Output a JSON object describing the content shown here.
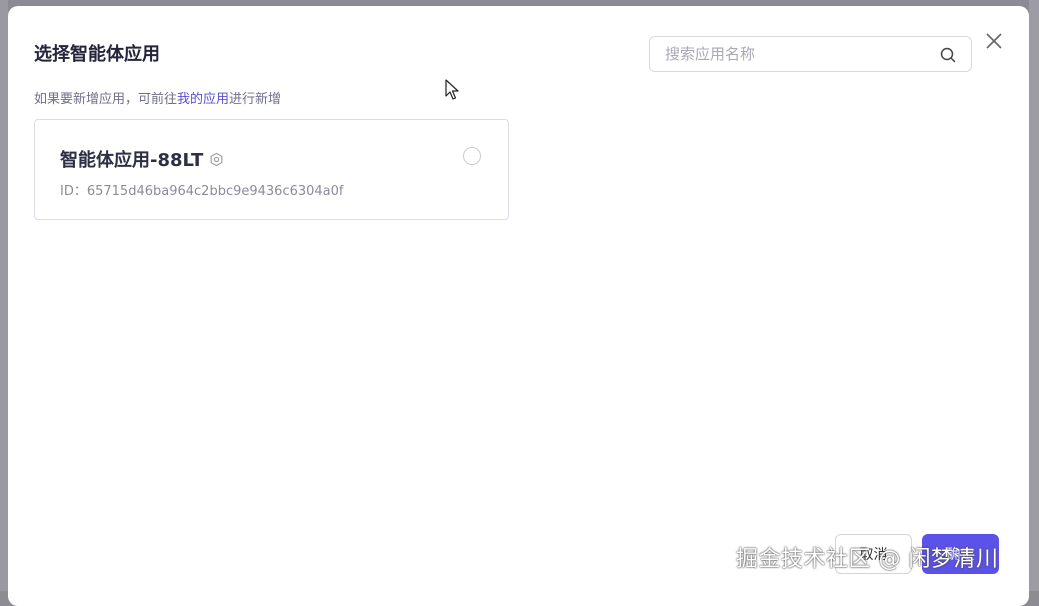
{
  "modal": {
    "title": "选择智能体应用",
    "hint_prefix": "如果要新增应用，可前往",
    "hint_link": "我的应用",
    "hint_suffix": "进行新增"
  },
  "search": {
    "placeholder": "搜索应用名称",
    "icon": "search-icon"
  },
  "close_icon": "close-icon",
  "apps": [
    {
      "name": "智能体应用-88LT",
      "badge_icon": "hexagon-icon",
      "id_text": "ID：65715d46ba964c2bbc9e9436c6304a0f",
      "selected": false
    }
  ],
  "footer": {
    "cancel_label": "取消",
    "confirm_label": "确定"
  },
  "watermark": "掘金技术社区 @ 闲梦清川",
  "colors": {
    "accent": "#5b52e8",
    "link": "#5a4fd6",
    "overlay": "#8c8a92"
  }
}
